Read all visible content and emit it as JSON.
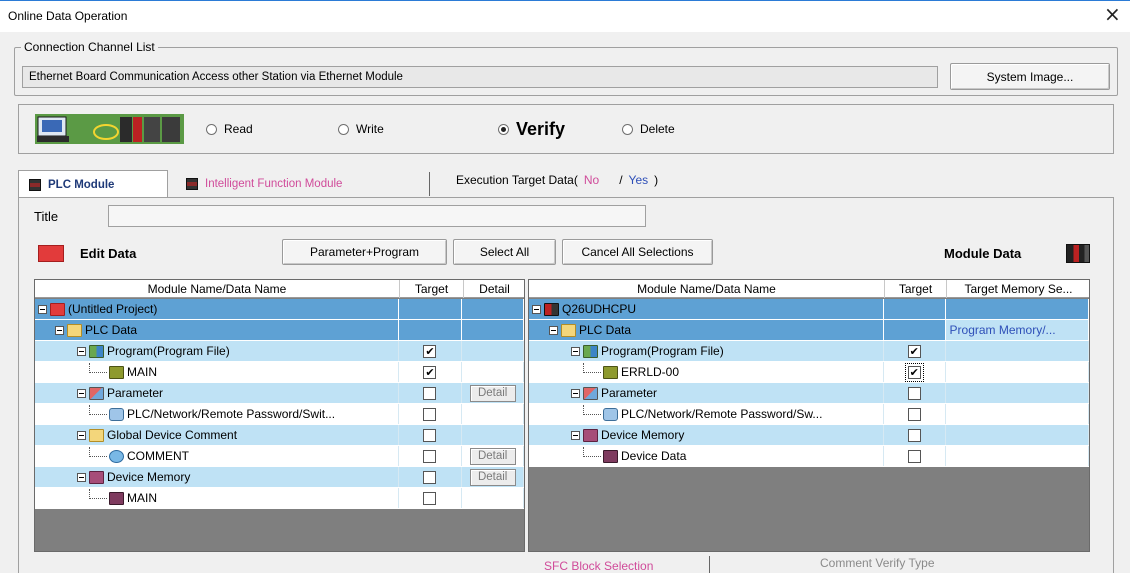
{
  "window": {
    "title": "Online Data Operation",
    "close_glyph": "×"
  },
  "connection": {
    "group_label": "Connection Channel List",
    "value": "Ethernet Board Communication  Access other Station via Ethernet Module",
    "system_image_button": "System Image..."
  },
  "operation": {
    "icon": "pc-plc-connection-icon",
    "options": [
      {
        "label": "Read",
        "selected": false
      },
      {
        "label": "Write",
        "selected": false
      },
      {
        "label": "Verify",
        "selected": true
      },
      {
        "label": "Delete",
        "selected": false
      }
    ]
  },
  "tabs": {
    "plc_module": "PLC Module",
    "intelligent": "Intelligent Function Module",
    "exec_label": "Execution Target Data(",
    "exec_no": "No",
    "exec_sep": "/",
    "exec_yes": "Yes",
    "exec_close": ")"
  },
  "title_field": {
    "label": "Title",
    "value": ""
  },
  "edit_data": {
    "label": "Edit Data",
    "buttons": {
      "param_program": "Parameter+Program",
      "select_all": "Select All",
      "cancel_all": "Cancel All Selections"
    }
  },
  "module_data": {
    "label": "Module Data"
  },
  "left_grid": {
    "headers": [
      "Module Name/Data Name",
      "Target",
      "Detail"
    ],
    "rows": [
      {
        "name": "(Untitled Project)",
        "style": "blue",
        "checkbox": null,
        "detail": null
      },
      {
        "name": "PLC Data",
        "style": "blue",
        "checkbox": null,
        "detail": null
      },
      {
        "name": "Program(Program File)",
        "style": "light",
        "checkbox": "✔",
        "detail": null
      },
      {
        "name": "MAIN",
        "style": "white",
        "checkbox": "✔",
        "detail": null
      },
      {
        "name": "Parameter",
        "style": "light",
        "checkbox": "",
        "detail": "Detail"
      },
      {
        "name": "PLC/Network/Remote Password/Swit...",
        "style": "white",
        "checkbox": "",
        "detail": null
      },
      {
        "name": "Global Device Comment",
        "style": "light",
        "checkbox": "",
        "detail": null
      },
      {
        "name": "COMMENT",
        "style": "white",
        "checkbox": "",
        "detail": "Detail"
      },
      {
        "name": "Device Memory",
        "style": "light",
        "checkbox": "",
        "detail": "Detail"
      },
      {
        "name": "MAIN",
        "style": "white",
        "checkbox": "",
        "detail": null
      }
    ]
  },
  "right_grid": {
    "headers": [
      "Module Name/Data Name",
      "Target",
      "Target Memory Se..."
    ],
    "rows": [
      {
        "name": "Q26UDHCPU",
        "style": "blue",
        "checkbox": null,
        "memory": ""
      },
      {
        "name": "PLC Data",
        "style": "blue",
        "checkbox": null,
        "memory": "Program Memory/..."
      },
      {
        "name": "Program(Program File)",
        "style": "light",
        "checkbox": "✔",
        "memory": ""
      },
      {
        "name": "ERRLD-00",
        "style": "white",
        "checkbox": "✔",
        "memory": ""
      },
      {
        "name": "Parameter",
        "style": "light",
        "checkbox": "",
        "memory": ""
      },
      {
        "name": "PLC/Network/Remote Password/Sw...",
        "style": "white",
        "checkbox": "",
        "memory": ""
      },
      {
        "name": "Device Memory",
        "style": "light",
        "checkbox": "",
        "memory": ""
      },
      {
        "name": "Device Data",
        "style": "white",
        "checkbox": "",
        "memory": ""
      }
    ]
  },
  "bottom": {
    "sfc_block": "SFC Block Selection",
    "comment_verify_type": "Comment Verify Type"
  }
}
